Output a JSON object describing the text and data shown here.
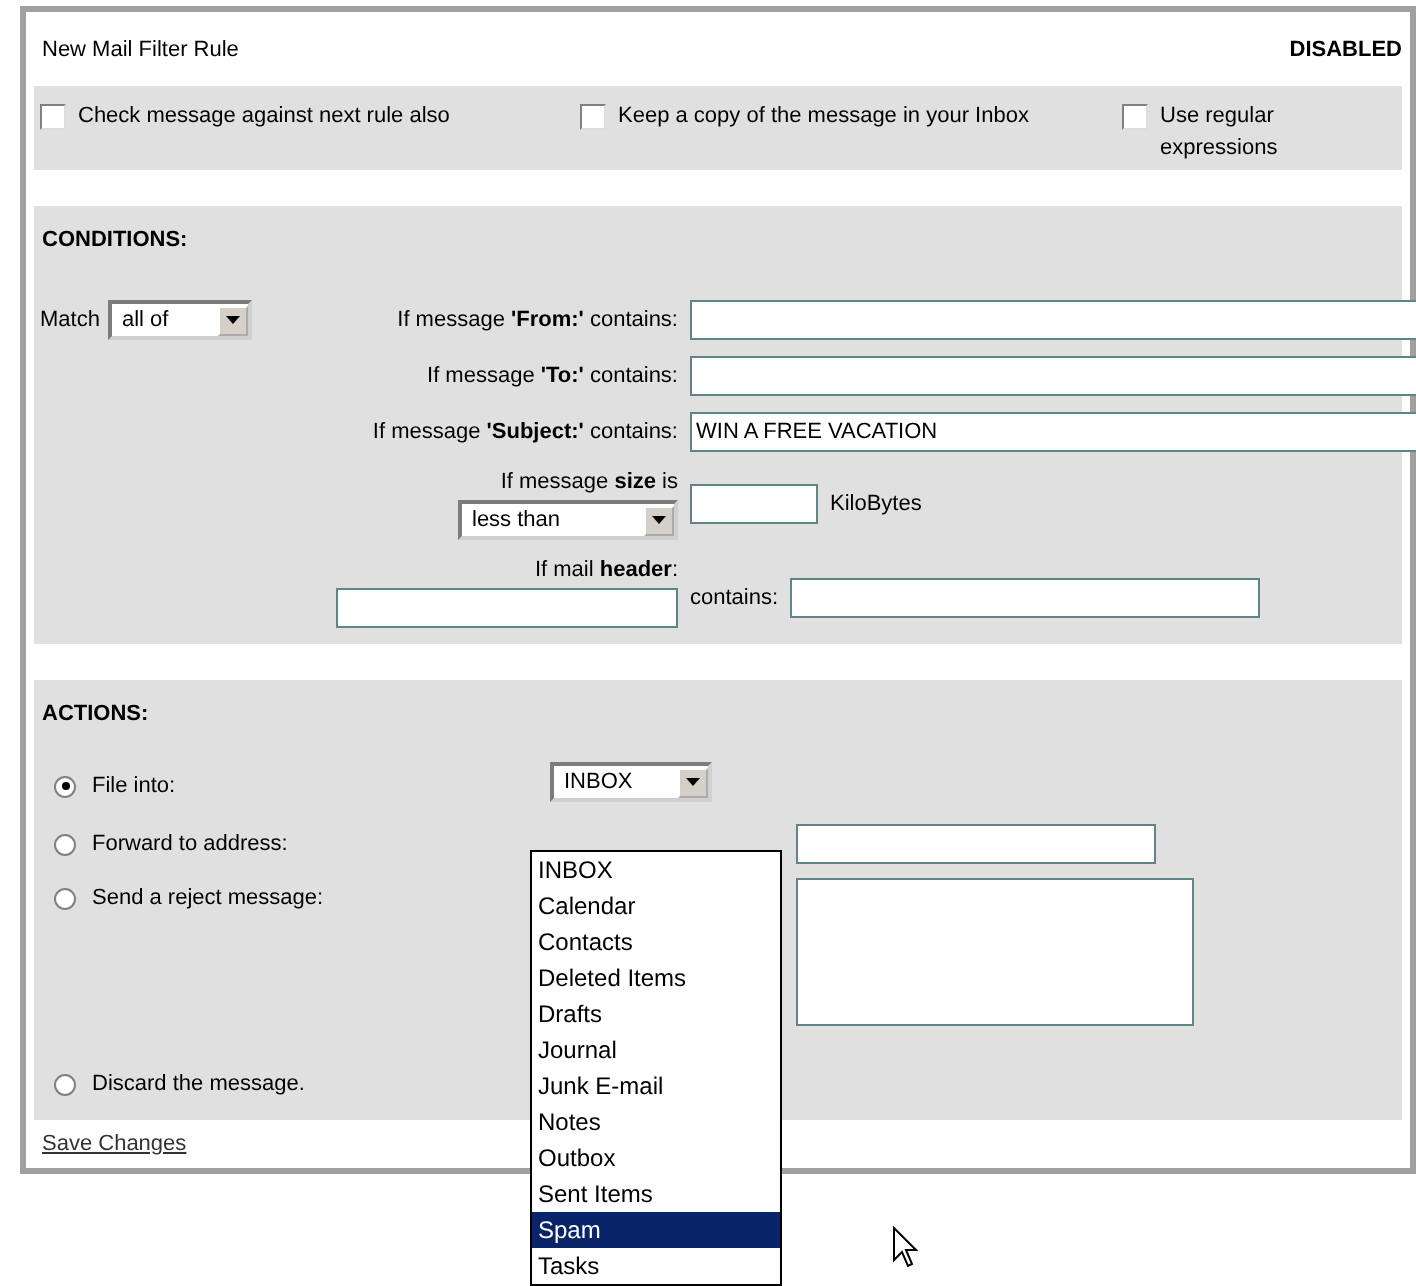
{
  "window": {
    "title": "New Mail Filter Rule",
    "status": "DISABLED"
  },
  "options": [
    {
      "label": "Check message against next rule also",
      "checked": false
    },
    {
      "label": "Keep a copy of the message in your Inbox",
      "checked": false
    },
    {
      "label": "Use regular expressions",
      "checked": false
    }
  ],
  "conditions": {
    "heading": "CONDITIONS:",
    "match": {
      "label": "Match",
      "value": "all of"
    },
    "rows": [
      {
        "kind": "text",
        "label": "If message **'From:'** contains:"
      },
      {
        "kind": "text",
        "label": "If message **'To:'** contains:"
      },
      {
        "kind": "text",
        "label": "If message **'Subject:'** contains:",
        "value": "WIN A FREE VACATION"
      },
      {
        "kind": "size",
        "label": "If message **size** is",
        "operator": "less than",
        "unit": "KiloBytes"
      },
      {
        "kind": "header",
        "label": "If mail **header**:",
        "contains_label": "contains:"
      }
    ]
  },
  "actions": {
    "heading": "ACTIONS:",
    "items": [
      {
        "kind": "folder",
        "label": "File into:",
        "selected": true,
        "value": "INBOX"
      },
      {
        "kind": "address",
        "label": "Forward to address:",
        "selected": false
      },
      {
        "kind": "reject",
        "label": "Send a reject message:",
        "selected": false
      },
      {
        "kind": "plain",
        "label": "Discard the message.",
        "selected": false
      }
    ]
  },
  "folder_menu": {
    "options": [
      {
        "label": "INBOX",
        "selected": false
      },
      {
        "label": "Calendar",
        "selected": false
      },
      {
        "label": "Contacts",
        "selected": false
      },
      {
        "label": "Deleted Items",
        "selected": false
      },
      {
        "label": "Drafts",
        "selected": false
      },
      {
        "label": "Journal",
        "selected": false
      },
      {
        "label": "Junk E-mail",
        "selected": false
      },
      {
        "label": "Notes",
        "selected": false
      },
      {
        "label": "Outbox",
        "selected": false
      },
      {
        "label": "Sent Items",
        "selected": false
      },
      {
        "label": "Spam",
        "selected": true
      },
      {
        "label": "Tasks",
        "selected": false
      }
    ]
  },
  "save_link": "Save Changes"
}
